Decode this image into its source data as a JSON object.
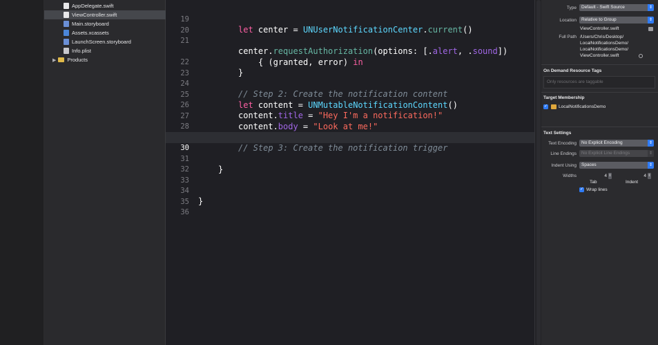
{
  "navigator": {
    "items": [
      {
        "name": "AppDelegate.swift",
        "kind": "swift"
      },
      {
        "name": "ViewController.swift",
        "kind": "swift"
      },
      {
        "name": "Main.storyboard",
        "kind": "storyboard"
      },
      {
        "name": "Assets.xcassets",
        "kind": "assets"
      },
      {
        "name": "LaunchScreen.storyboard",
        "kind": "storyboard"
      },
      {
        "name": "Info.plist",
        "kind": "plist"
      },
      {
        "name": "Products",
        "kind": "folder"
      }
    ]
  },
  "editor": {
    "current_line": "30",
    "lines": [
      {
        "n": "19",
        "code": "let center = UNUserNotificationCenter.current()"
      },
      {
        "n": "20",
        "code": ""
      },
      {
        "n": "21",
        "code": "center.requestAuthorization(options: [.alert, .sound])"
      },
      {
        "n": "",
        "code": "{ (granted, error) in"
      },
      {
        "n": "22",
        "code": "}"
      },
      {
        "n": "23",
        "code": ""
      },
      {
        "n": "24",
        "code": "// Step 2: Create the notification content"
      },
      {
        "n": "25",
        "code": "let content = UNMutableNotificationContent()"
      },
      {
        "n": "26",
        "code": "content.title = \"Hey I'm a notification!\""
      },
      {
        "n": "27",
        "code": "content.body = \"Look at me!\""
      },
      {
        "n": "28",
        "code": ""
      },
      {
        "n": "29",
        "code": "// Step 3: Create the notification trigger"
      },
      {
        "n": "30",
        "code": ""
      },
      {
        "n": "31",
        "code": "}"
      },
      {
        "n": "32",
        "code": ""
      },
      {
        "n": "33",
        "code": ""
      },
      {
        "n": "34",
        "code": "}"
      },
      {
        "n": "35",
        "code": ""
      },
      {
        "n": "36",
        "code": ""
      }
    ]
  },
  "inspector": {
    "type_label": "Type",
    "type_value": "Default - Swift Source",
    "location_label": "Location",
    "location_value": "Relative to Group",
    "location_file": "ViewController.swift",
    "fullpath_label": "Full Path",
    "fullpath_lines": [
      "/Users/Chris/Desktop/",
      "LocalNotificationsDemo/",
      "LocalNotificationsDemo/",
      "ViewController.swift"
    ],
    "odr_title": "On Demand Resource Tags",
    "odr_placeholder": "Only resources are taggable",
    "target_title": "Target Membership",
    "target_name": "LocalNotificationsDemo",
    "text_settings_title": "Text Settings",
    "encoding_label": "Text Encoding",
    "encoding_value": "No Explicit Encoding",
    "line_endings_label": "Line Endings",
    "line_endings_value": "No Explicit Line Endings",
    "indent_using_label": "Indent Using",
    "indent_using_value": "Spaces",
    "widths_label": "Widths",
    "tab_width": "4",
    "indent_width": "4",
    "tab_label": "Tab",
    "indent_label": "Indent",
    "wrap_lines_label": "Wrap lines"
  }
}
